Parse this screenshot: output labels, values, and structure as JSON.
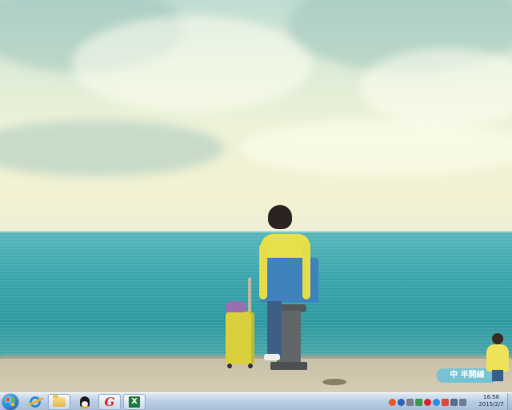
{
  "desktop": {
    "wallpaper": "seaside-boy-with-suitcase",
    "widget": {
      "label": "中 半開線"
    }
  },
  "taskbar": {
    "start_icon": "windows-start-orb",
    "apps": [
      {
        "name": "Internet Explorer",
        "icon": "ie-icon",
        "active": false
      },
      {
        "name": "Windows Explorer",
        "icon": "folder-icon",
        "active": true
      },
      {
        "name": "QQ",
        "icon": "qq-penguin-icon",
        "active": false
      },
      {
        "name": "G app",
        "icon": "g-app-icon",
        "glyph": "G",
        "active": true
      },
      {
        "name": "Excel",
        "icon": "excel-icon",
        "glyph": "X",
        "active": true
      }
    ],
    "tray_icons": [
      "sogou-icon",
      "help-icon",
      "usb-icon",
      "network-icon",
      "g-tray-icon",
      "shield-icon",
      "flag-icon",
      "display-icon",
      "volume-icon"
    ],
    "clock": {
      "time": "16:56",
      "date": "2015/2/7"
    }
  },
  "colors": {
    "taskbar": "#b9cde2",
    "sea": "#3aa5ac",
    "sky": "#eef3d8"
  }
}
